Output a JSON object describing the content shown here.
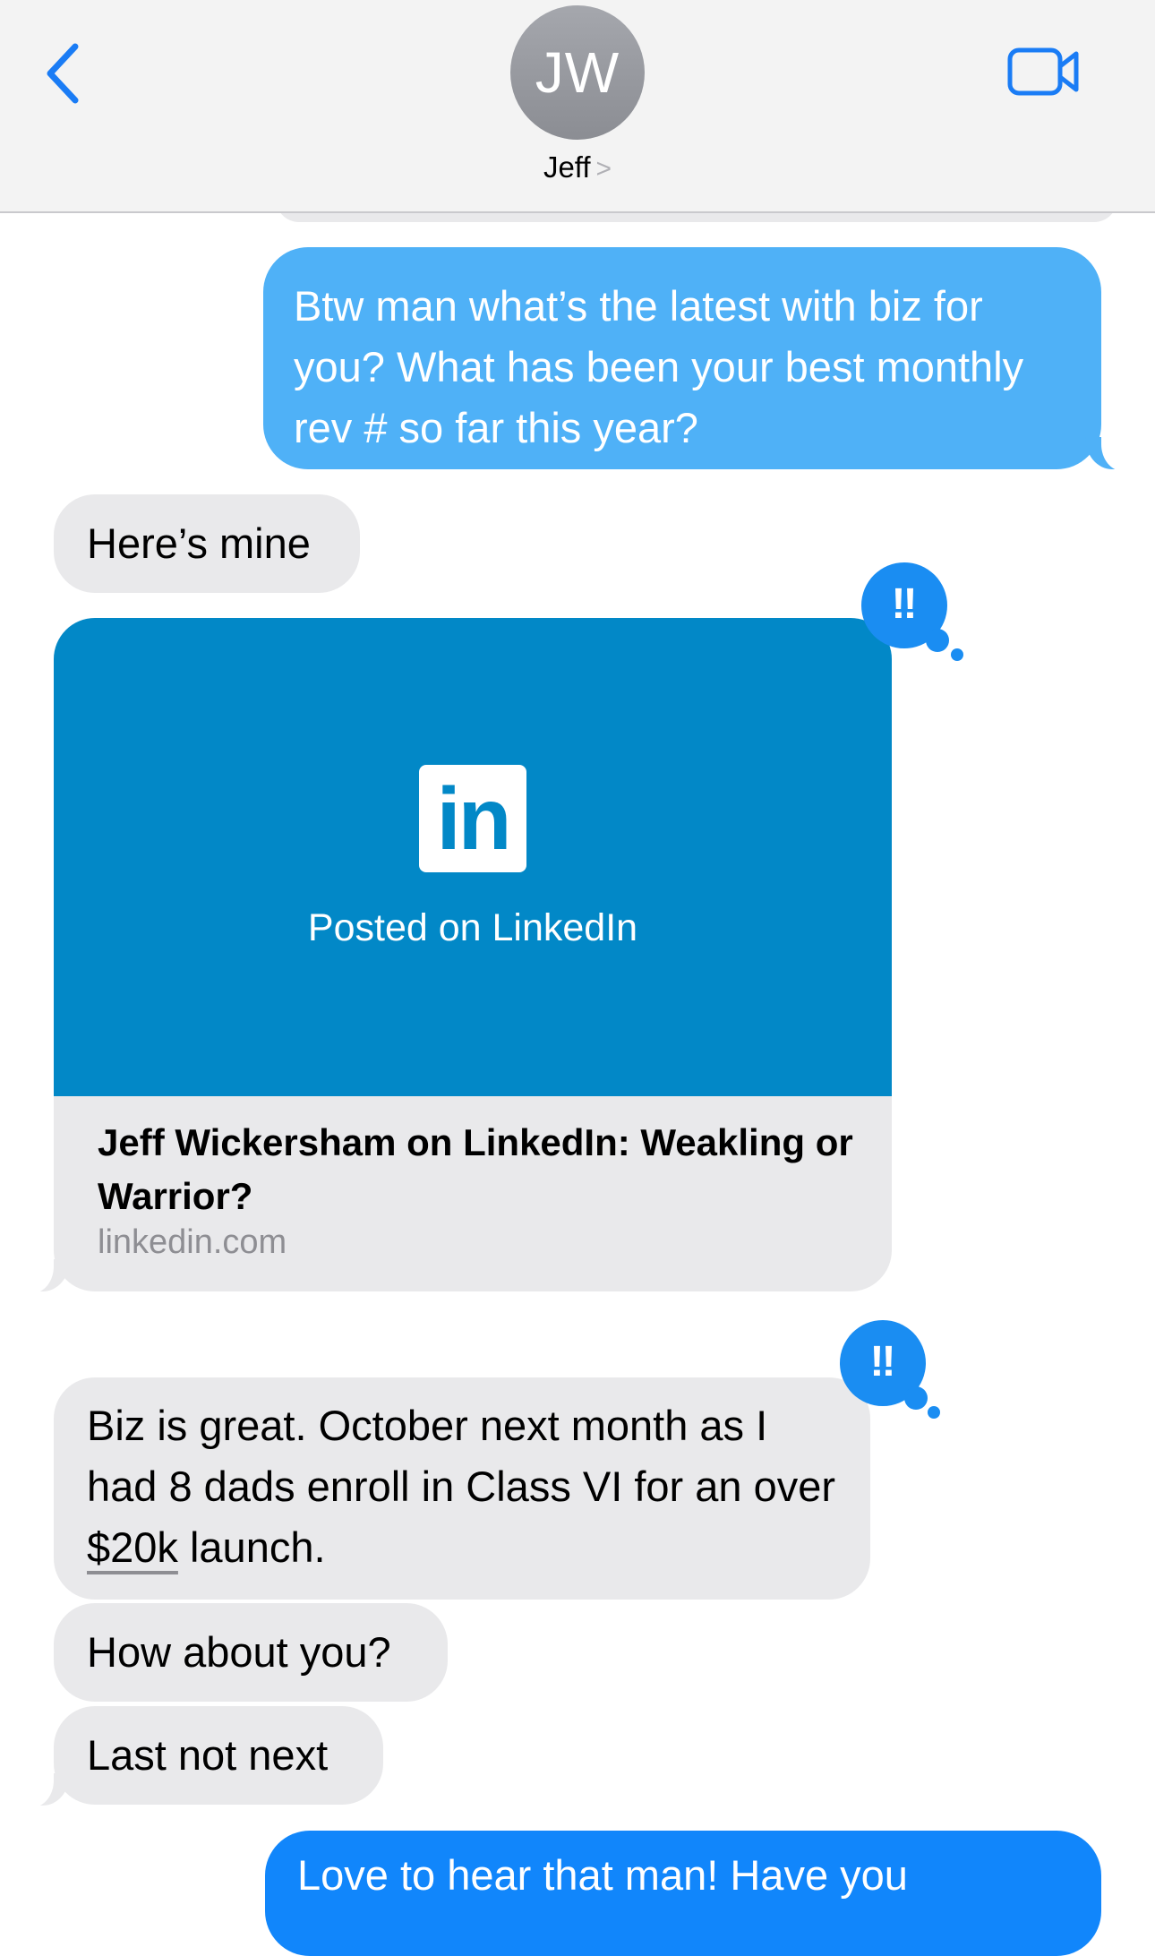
{
  "header": {
    "avatar_initials": "JW",
    "contact_name": "Jeff",
    "contact_chevron": ">",
    "back_icon": "chevron-left-icon",
    "video_icon": "video-camera-icon",
    "accent_color": "#1a7cf5"
  },
  "messages": {
    "m1": "Btw man what’s the latest with biz for you? What has been your best monthly rev # so far this year?",
    "m2": "Here’s mine",
    "link": {
      "logo_text": "in",
      "hero_caption": "Posted on LinkedIn",
      "title": "Jeff Wickersham on LinkedIn: Weakling or Warrior?",
      "domain": "linkedin.com",
      "reaction": "‼"
    },
    "m3_part1": "Biz is great. October next month as I had 8 dads enroll in Class VI for an over ",
    "m3_amount": "$20k",
    "m3_part2": " launch.",
    "m3_reaction": "‼",
    "m4": "How about you?",
    "m5": "Last not next",
    "m6": "Love to hear that man! Have you"
  },
  "colors": {
    "outgoing_light": "#4fb1f7",
    "outgoing": "#1186fb",
    "incoming": "#e9e9eb",
    "linkedin_blue": "#0288c7",
    "tapback": "#1a8df2"
  }
}
